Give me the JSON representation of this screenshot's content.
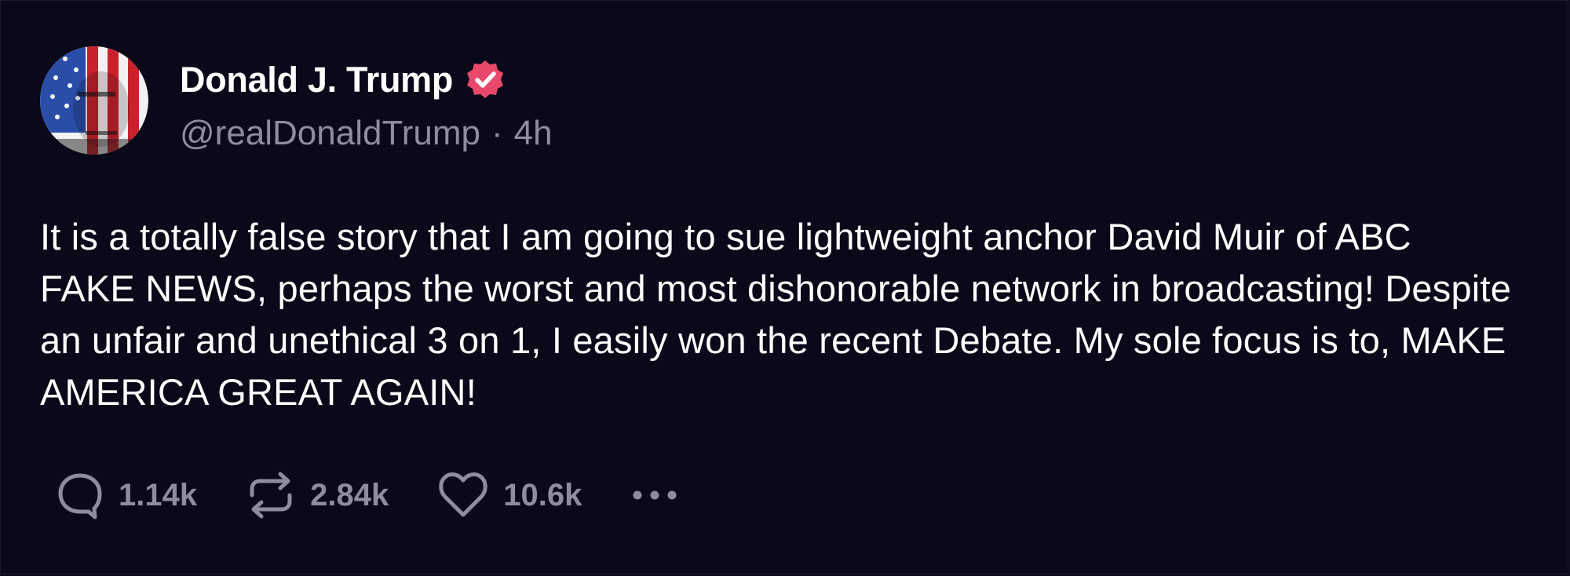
{
  "author": {
    "display_name": "Donald J. Trump",
    "handle": "@realDonaldTrump",
    "separator": "·",
    "age": "4h",
    "verified_icon": "verified-badge-icon",
    "verified_color": "#e8496b"
  },
  "post": {
    "text": "It is a totally false story that I am going to sue lightweight anchor David Muir of ABC FAKE NEWS, perhaps the worst and most dishonorable network in broadcasting! Despite an unfair and unethical 3 on 1, I easily won the recent Debate. My sole focus is to, MAKE AMERICA GREAT AGAIN!"
  },
  "actions": {
    "replies": {
      "icon": "reply-icon",
      "count": "1.14k"
    },
    "retruths": {
      "icon": "repost-icon",
      "count": "2.84k"
    },
    "likes": {
      "icon": "heart-icon",
      "count": "10.6k"
    },
    "more": {
      "icon": "more-icon"
    }
  },
  "colors": {
    "background": "#0a0919",
    "text": "#ffffff",
    "muted": "#8e8d9f"
  }
}
